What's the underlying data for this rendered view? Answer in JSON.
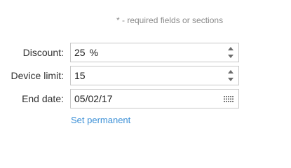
{
  "form": {
    "required_note": "* - required fields or sections",
    "discount": {
      "label": "Discount:",
      "value": "25",
      "unit": "%"
    },
    "device_limit": {
      "label": "Device limit:",
      "value": "15"
    },
    "end_date": {
      "label": "End date:",
      "value": "05/02/17"
    },
    "set_permanent_label": "Set permanent"
  },
  "icons": {
    "spinner_up": "caret-up-icon",
    "spinner_down": "caret-down-icon",
    "calendar": "calendar-grid-icon"
  },
  "colors": {
    "link": "#3a8fd6",
    "label_text": "#333333",
    "note_text": "#8a8a8a",
    "field_border": "#c8c8c8"
  }
}
